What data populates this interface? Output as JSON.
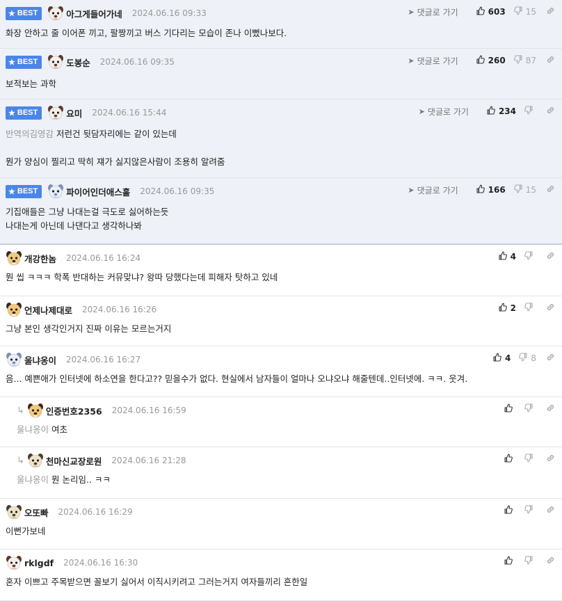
{
  "best_label": "BEST",
  "goto_label": "댓글로 가기",
  "comments": [
    {
      "best": true,
      "nick": "아그게들어가네",
      "time": "2024.06.16 09:33",
      "lines": [
        "화장 안하고 줄 이어폰 끼고, 팔짱끼고 버스 기다리는 모습이 존나 이뻤나보다."
      ],
      "up": "603",
      "down": "15",
      "avatar": "dog"
    },
    {
      "best": true,
      "nick": "도봉순",
      "time": "2024.06.16 09:35",
      "lines": [
        "보적보는 과학"
      ],
      "up": "260",
      "down": "87",
      "avatar": "dog"
    },
    {
      "best": true,
      "nick": "요미",
      "time": "2024.06.16 15:44",
      "mention": "반역의김영감",
      "lines": [
        "저런건 뒷담자리에는 같이 있는데",
        "",
        "뭔가 양심이 찔리고 딱히 쟤가 싫지않은사람이 조용히 알려줌"
      ],
      "up": "234",
      "down": "",
      "avatar": "dog"
    },
    {
      "best": true,
      "nick": "파이어인더애스홀",
      "time": "2024.06.16 09:35",
      "lines": [
        "기집애들은 그냥 나대는걸 극도로 싫어하는듯",
        "나대는게 아닌데 나댄다고 생각하나봐"
      ],
      "up": "166",
      "down": "15",
      "avatar": "puppy"
    },
    {
      "best": false,
      "nick": "개강한놈",
      "time": "2024.06.16 16:24",
      "lines": [
        "뭔 씹 ㅋㅋㅋ 학폭 반대하는 커뮤맞냐? 왕따 당했다는데 피해자 탓하고 있네"
      ],
      "up": "4",
      "down": "",
      "avatar": "fox"
    },
    {
      "best": false,
      "nick": "언제나제대로",
      "time": "2024.06.16 16:26",
      "lines": [
        "그냥 본인 생각인거지 진짜 이유는 모르는거지"
      ],
      "up": "2",
      "down": "",
      "avatar": "fox"
    },
    {
      "best": false,
      "nick": "울냐옹이",
      "time": "2024.06.16 16:27",
      "lines": [
        "음... 예쁜애가 인터넷에 하소연을 한다고?? 믿을수가 없다. 현실에서 남자들이 얼마나 오냐오냐 해줄텐데..인터넷에. ㅋㅋ. 웃겨."
      ],
      "up": "4",
      "down": "8",
      "avatar": "puppy"
    },
    {
      "best": false,
      "reply": true,
      "nick": "인증번호2356",
      "time": "2024.06.16 16:59",
      "mention": "울냐옹이",
      "lines": [
        "여초"
      ],
      "up": "",
      "down": "",
      "avatar": "fox"
    },
    {
      "best": false,
      "reply": true,
      "nick": "천마신교장로원",
      "time": "2024.06.16 21:28",
      "mention": "울냐옹이",
      "lines": [
        "뭔 논리임.. ㅋㅋ"
      ],
      "up": "",
      "down": "",
      "avatar": "chick"
    },
    {
      "best": false,
      "nick": "오또빠",
      "time": "2024.06.16 16:29",
      "lines": [
        "이뻔가보네"
      ],
      "up": "",
      "down": "",
      "avatar": "chick"
    },
    {
      "best": false,
      "nick": "rklgdf",
      "time": "2024.06.16 16:30",
      "lines": [
        "혼자 이쁘고 주목받으면 꼴보기 싫어서 이직시키려고 그러는거지 여자들끼리 흔한일"
      ],
      "up": "",
      "down": "",
      "avatar": "dog"
    }
  ]
}
